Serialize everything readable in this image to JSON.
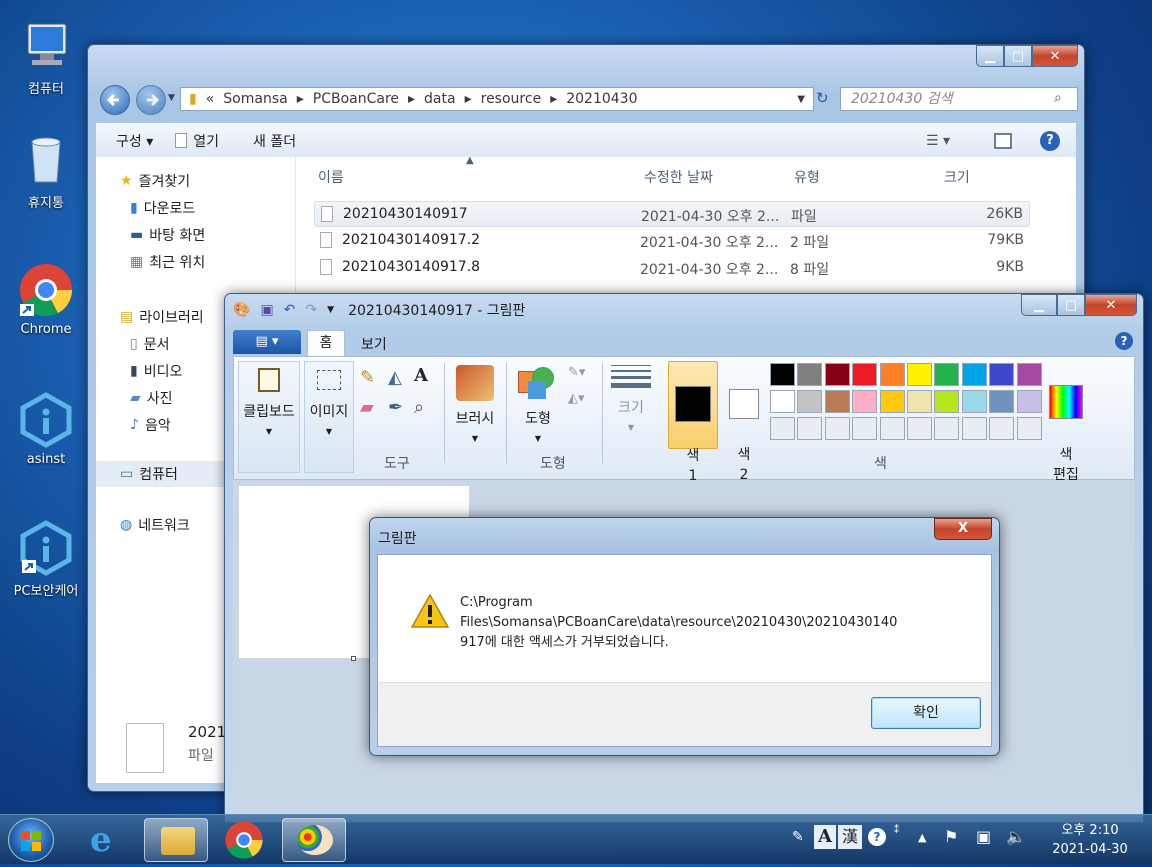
{
  "desktop": {
    "icons": [
      {
        "label": "컴퓨터",
        "icon": "computer-icon"
      },
      {
        "label": "휴지통",
        "icon": "recycle-bin-icon"
      },
      {
        "label": "Chrome",
        "icon": "chrome-icon"
      },
      {
        "label": "asinst",
        "icon": "asinst-icon"
      },
      {
        "label": "PC보안케어",
        "icon": "pc-security-care-icon"
      }
    ]
  },
  "explorer": {
    "breadcrumb": [
      "«",
      "Somansa",
      "PCBoanCare",
      "data",
      "resource",
      "20210430"
    ],
    "search_placeholder": "20210430 검색",
    "toolbar": {
      "organize": "구성 ▾",
      "open": "열기",
      "new_folder": "새 폴더"
    },
    "nav": {
      "favorites": "즐겨찾기",
      "downloads": "다운로드",
      "desktop": "바탕 화면",
      "recent": "최근 위치",
      "libraries": "라이브러리",
      "documents": "문서",
      "videos": "비디오",
      "pictures": "사진",
      "music": "음악",
      "computer": "컴퓨터",
      "network": "네트워크"
    },
    "columns": {
      "name": "이름",
      "date": "수정한 날짜",
      "type": "유형",
      "size": "크기"
    },
    "files": [
      {
        "name": "20210430140917",
        "date": "2021-04-30 오후 2...",
        "type": "파일",
        "size": "26KB"
      },
      {
        "name": "20210430140917.2",
        "date": "2021-04-30 오후 2...",
        "type": "2 파일",
        "size": "79KB"
      },
      {
        "name": "20210430140917.8",
        "date": "2021-04-30 오후 2...",
        "type": "8 파일",
        "size": "9KB"
      }
    ],
    "details": {
      "name": "2021",
      "type": "파일"
    }
  },
  "paint": {
    "title": "20210430140917 - 그림판",
    "tabs": {
      "home": "홈",
      "view": "보기"
    },
    "groups": {
      "clipboard": "클립보드",
      "image": "이미지",
      "tools": "도구",
      "brushes": "브러시",
      "shapes": "도형",
      "shapes_group": "도형",
      "size": "크기",
      "color1": "색\n1",
      "color2": "색\n2",
      "edit_colors": "색\n편집",
      "colors": "색"
    },
    "palette_row1": [
      "#000000",
      "#7f7f7f",
      "#880015",
      "#ed1c24",
      "#ff7f27",
      "#fff200",
      "#22b14c",
      "#00a2e8",
      "#3f48cc",
      "#a349a4"
    ],
    "palette_row2": [
      "#ffffff",
      "#c3c3c3",
      "#b97a57",
      "#ffaec9",
      "#ffc90e",
      "#efe4b0",
      "#b5e61d",
      "#99d9ea",
      "#7092be",
      "#c8bfe7"
    ]
  },
  "dialog": {
    "title": "그림판",
    "message_line1": "C:\\Program",
    "message_line2": "Files\\Somansa\\PCBoanCare\\data\\resource\\20210430\\20210430140",
    "message_line3": "917에 대한 액세스가 거부되었습니다.",
    "ok": "확인",
    "close": "X"
  },
  "taskbar": {
    "ime_a": "A",
    "ime_han": "漢",
    "time": "오후 2:10",
    "date": "2021-04-30"
  }
}
